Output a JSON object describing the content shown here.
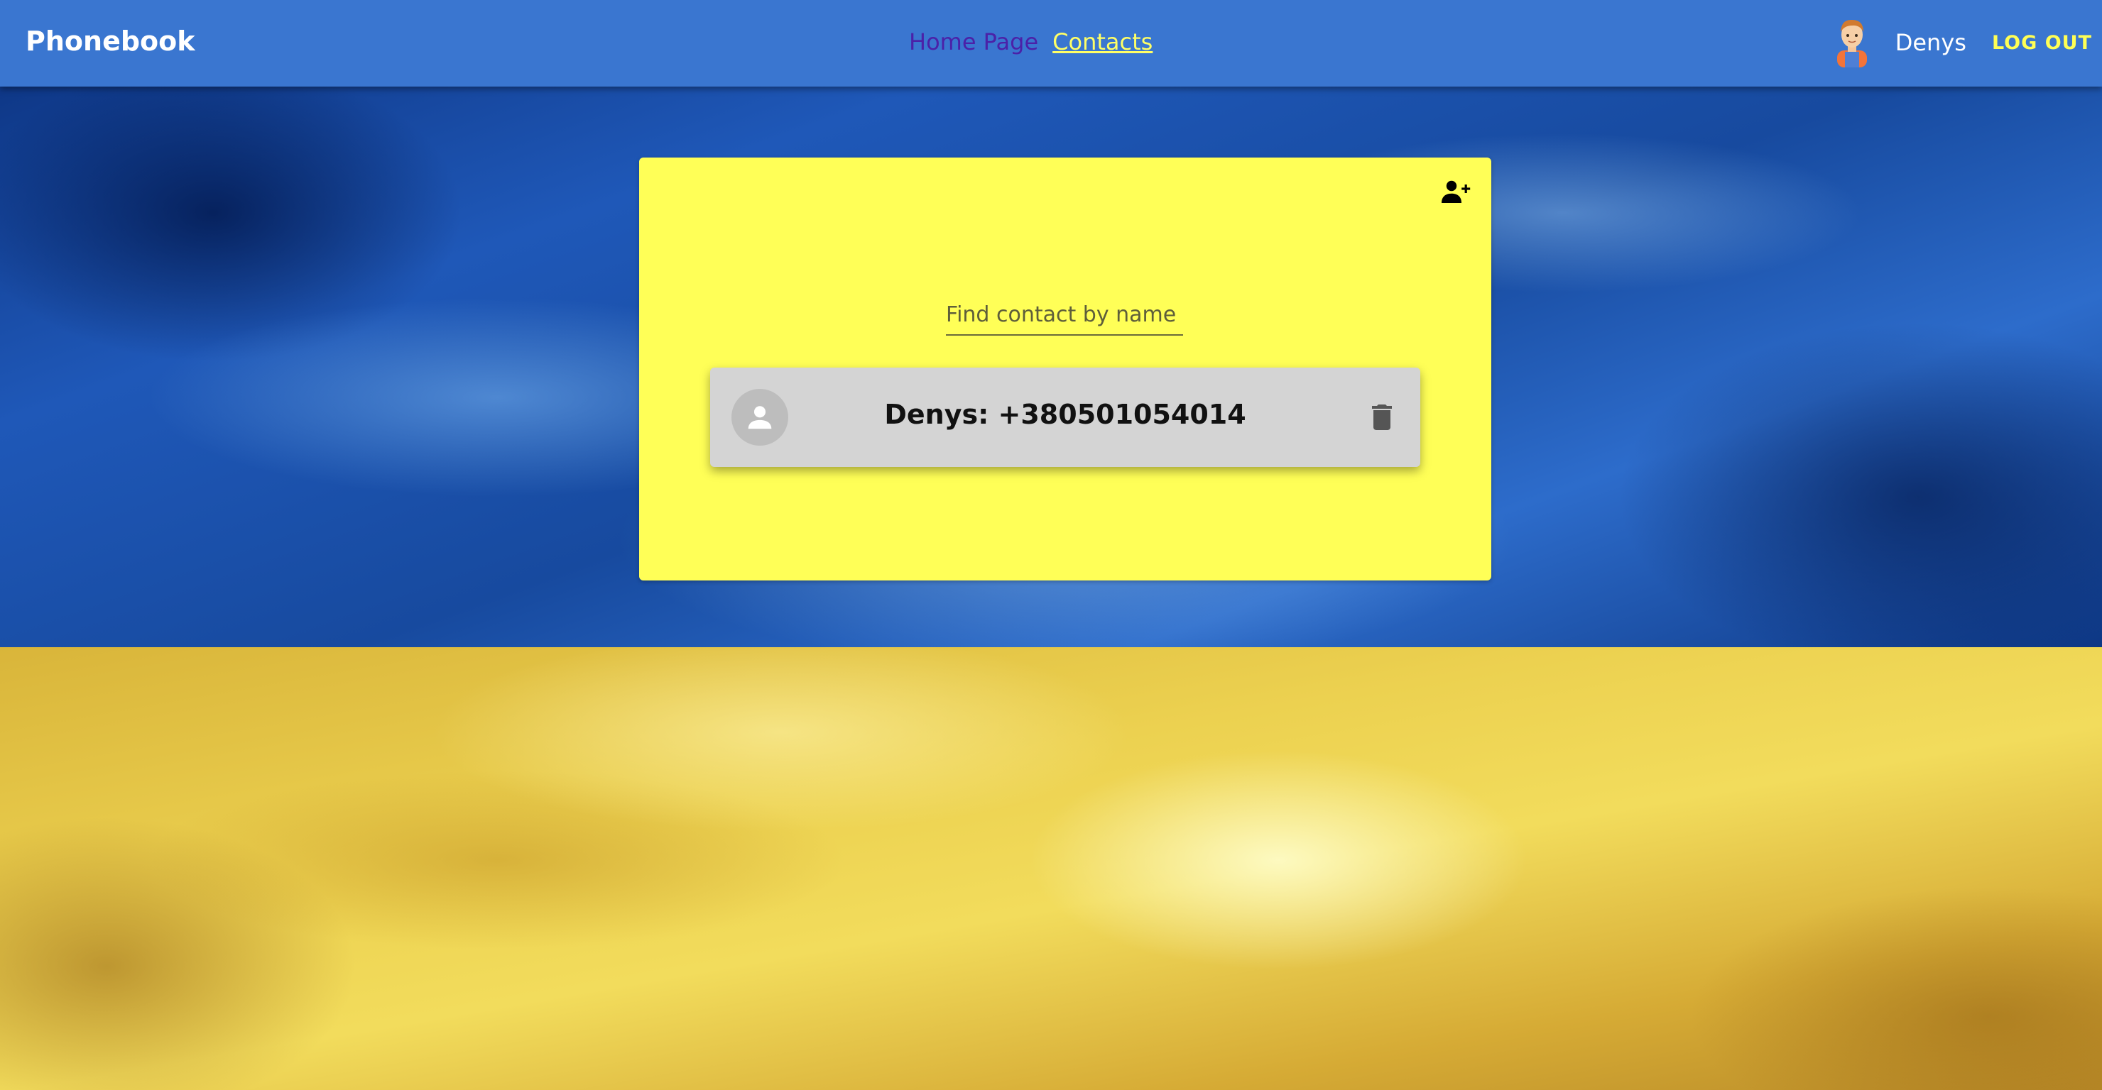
{
  "header": {
    "brand": "Phonebook",
    "nav": {
      "home_label": "Home Page",
      "contacts_label": "Contacts"
    },
    "user": {
      "name": "Denys",
      "logout_label": "LOG OUT"
    }
  },
  "contacts_panel": {
    "add_contact_icon": "person-add-icon",
    "search": {
      "value": "",
      "placeholder": "Find contact by name"
    },
    "contacts": [
      {
        "name": "Denys",
        "number": "+380501054014",
        "display": "Denys: +380501054014",
        "avatar_icon": "person-icon",
        "delete_icon": "trash-icon"
      }
    ]
  },
  "colors": {
    "appbar": "#3a76d0",
    "card": "#ffff57",
    "contact_item": "#d4d4d4",
    "active_link": "#ffff66",
    "inactive_link": "#4b21a8"
  }
}
